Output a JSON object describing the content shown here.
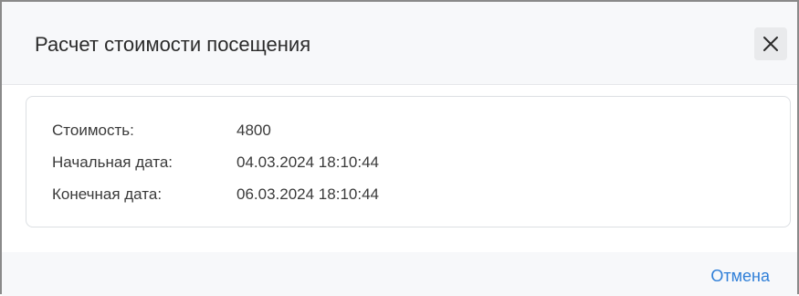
{
  "dialog": {
    "title": "Расчет стоимости посещения",
    "close_icon": "close-icon"
  },
  "details": {
    "cost_label": "Стоимость:",
    "cost_value": "4800",
    "start_label": "Начальная дата:",
    "start_value": "04.03.2024 18:10:44",
    "end_label": "Конечная дата:",
    "end_value": "06.03.2024 18:10:44"
  },
  "footer": {
    "cancel_label": "Отмена"
  },
  "colors": {
    "link": "#2f7fd8",
    "header_bg": "#f7f8fa",
    "card_border": "#dcdfe3"
  }
}
